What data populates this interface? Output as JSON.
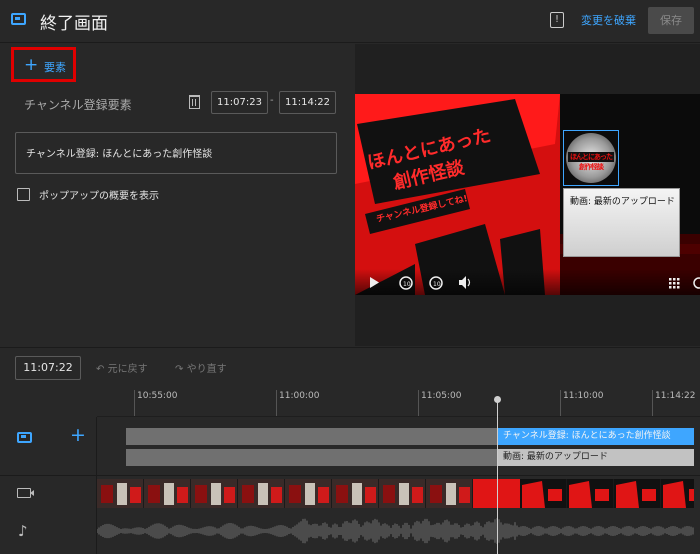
{
  "header": {
    "title": "終了画面",
    "discard_label": "変更を破棄",
    "save_label": "保存",
    "feedback_glyph": "!"
  },
  "left_panel": {
    "add_element_label": "要素",
    "channel_element_label": "チャンネル登録要素",
    "start_time": "11:07:23",
    "end_time": "11:14:22",
    "time_separator": "-",
    "channel_field_value": "チャンネル登録: ほんとにあった創作怪談",
    "show_popup_overview_label": "ポップアップの概要を表示",
    "show_popup_overview_checked": false
  },
  "preview": {
    "thumbnail_text_main": "ほんとにあった\n創作怪談",
    "thumbnail_text_sub": "チャンネル登録してね!",
    "channel_logo_text": "ほんとにあった創作怪談",
    "video_element_label": "動画: 最新のアップロード",
    "colors": {
      "thumbnail_red": "#ff1a1a",
      "thumbnail_dark": "#1a1a1a",
      "accent": "#3ea6ff"
    }
  },
  "timeline": {
    "current_time": "11:07:22",
    "undo_label": "元に戻す",
    "redo_label": "やり直す",
    "ticks": [
      "10:55:00",
      "11:00:00",
      "11:05:00",
      "11:10:00",
      "11:14:22"
    ],
    "tracks": {
      "channel_track_label": "チャンネル登録: ほんとにあった創作怪談",
      "video_track_label": "動画: 最新のアップロード"
    }
  }
}
